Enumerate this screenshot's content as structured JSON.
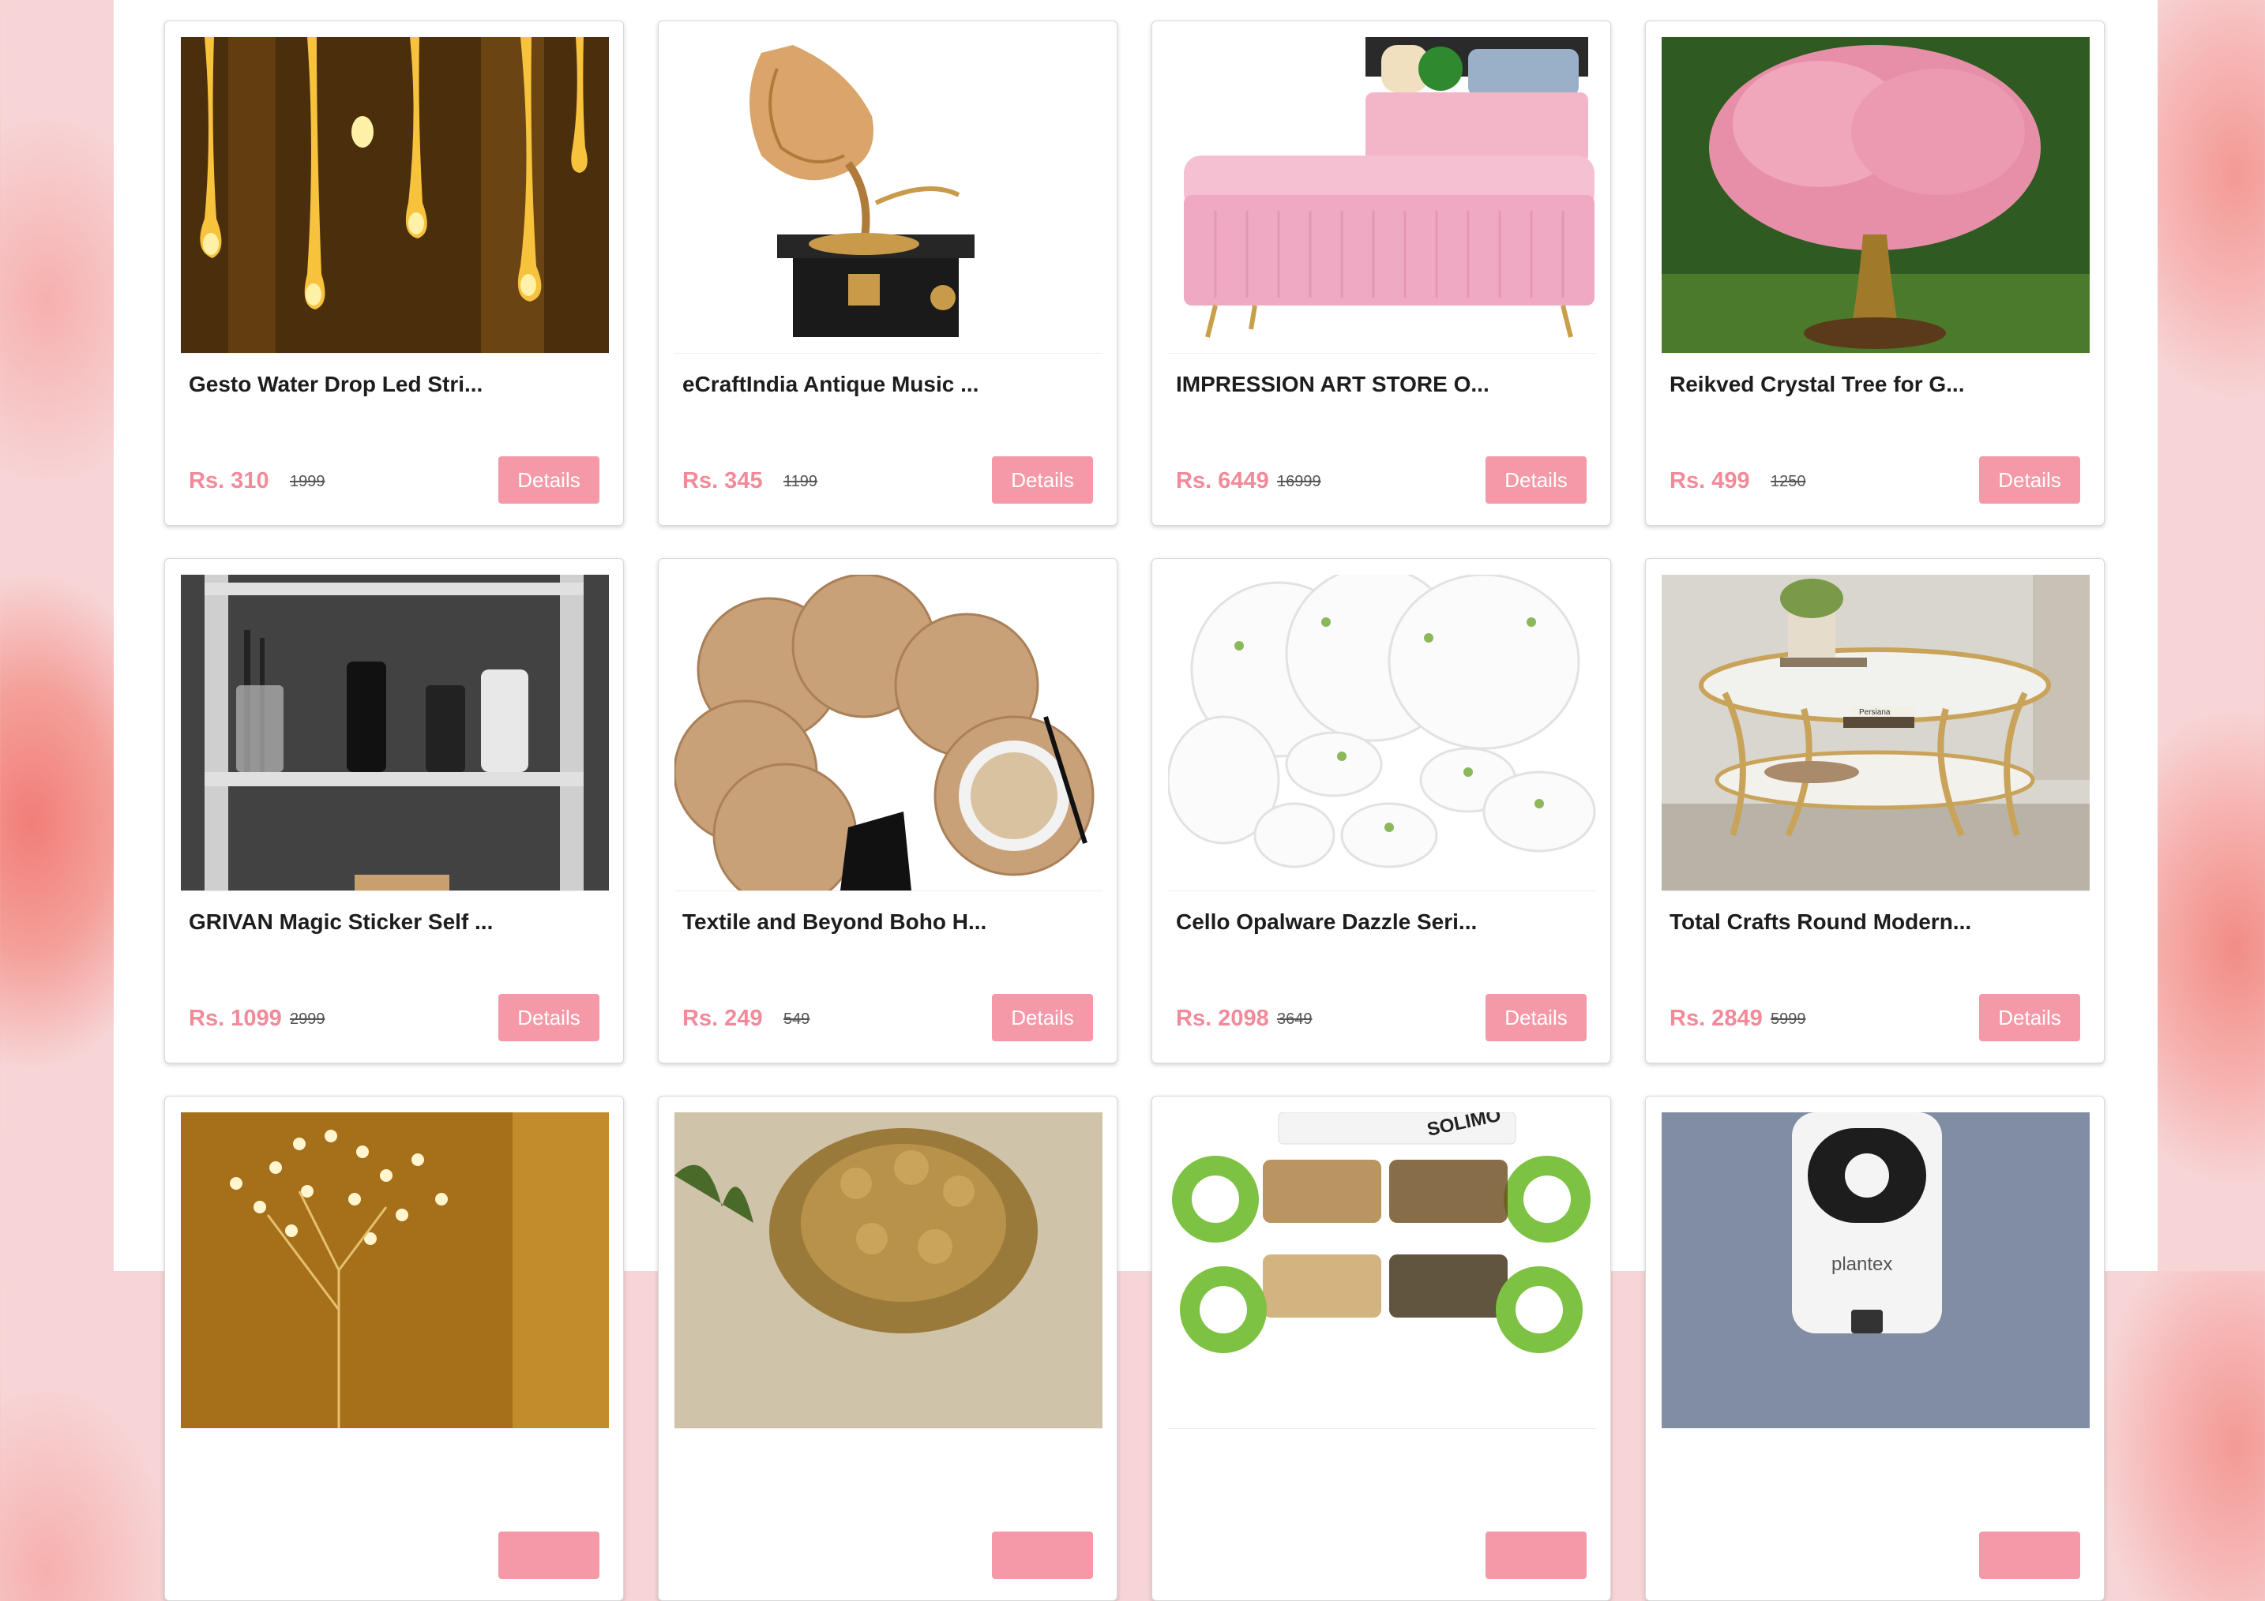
{
  "products": [
    {
      "title": "Gesto Water Drop Led Stri...",
      "price": "Rs. 310",
      "mrp": "1999",
      "button": "Details",
      "image": "water-drop-led-lights-image"
    },
    {
      "title": "eCraftIndia Antique Music ...",
      "price": "Rs. 345",
      "mrp": "1199",
      "button": "Details",
      "image": "gramophone-image"
    },
    {
      "title": "IMPRESSION ART STORE O...",
      "price": "Rs. 6449",
      "mrp": "16999",
      "button": "Details",
      "image": "pink-ottoman-bench-image"
    },
    {
      "title": "Reikved Crystal Tree for G...",
      "price": "Rs. 499",
      "mrp": "1250",
      "button": "Details",
      "image": "crystal-tree-image"
    },
    {
      "title": "GRIVAN Magic Sticker Self ...",
      "price": "Rs. 1099",
      "mrp": "2999",
      "button": "Details",
      "image": "bathroom-shelf-image"
    },
    {
      "title": "Textile and Beyond Boho H...",
      "price": "Rs. 249",
      "mrp": "549",
      "button": "Details",
      "image": "jute-coasters-image"
    },
    {
      "title": "Cello Opalware Dazzle Seri...",
      "price": "Rs. 2098",
      "mrp": "3649",
      "button": "Details",
      "image": "dinner-set-image"
    },
    {
      "title": "Total Crafts Round Modern...",
      "price": "Rs. 2849",
      "mrp": "5999",
      "button": "Details",
      "image": "coffee-table-image"
    },
    {
      "title": "",
      "price": "",
      "mrp": "",
      "button": "",
      "image": "fairy-light-tree-image"
    },
    {
      "title": "",
      "price": "",
      "mrp": "",
      "button": "",
      "image": "brass-tree-decor-image"
    },
    {
      "title": "",
      "price": "",
      "mrp": "",
      "button": "",
      "image": "spice-rack-image"
    },
    {
      "title": "",
      "price": "",
      "mrp": "",
      "button": "",
      "image": "wall-dispenser-image"
    }
  ],
  "overlay_text": {
    "solimo": "SOLIMO",
    "plantex": "plantex",
    "persiana": "Persiana"
  },
  "colors": {
    "price": "#f28a9a",
    "button": "#f599a8",
    "background": "#f7d5d7"
  }
}
